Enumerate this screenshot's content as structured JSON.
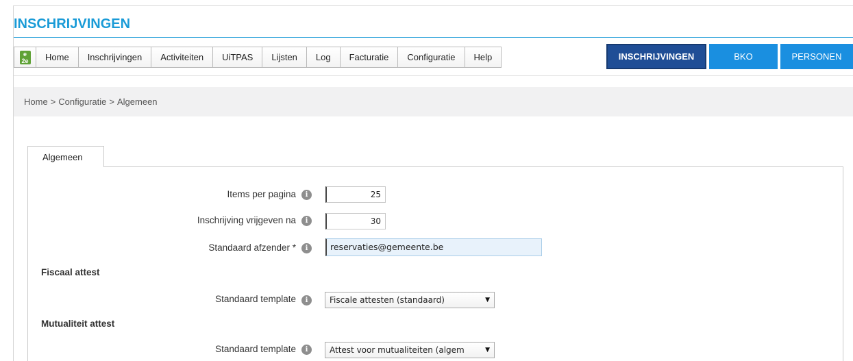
{
  "app": {
    "title": "INSCHRIJVINGEN"
  },
  "menu": {
    "logo": "e2e-logo-icon",
    "items": [
      "Home",
      "Inschrijvingen",
      "Activiteiten",
      "UiTPAS",
      "Lijsten",
      "Log",
      "Facturatie",
      "Configuratie",
      "Help"
    ]
  },
  "modules": {
    "inschrijvingen": "INSCHRIJVINGEN",
    "bko": "BKO",
    "personen": "PERSONEN",
    "active": "INSCHRIJVINGEN"
  },
  "breadcrumb": {
    "home": "Home",
    "sep": ">",
    "configuratie": "Configuratie",
    "current": "Algemeen"
  },
  "tab": {
    "label": "Algemeen"
  },
  "form": {
    "items_per_page": {
      "label": "Items per pagina",
      "value": "25"
    },
    "release_after": {
      "label": "Inschrijving vrijgeven na",
      "value": "30"
    },
    "default_sender": {
      "label": "Standaard afzender *",
      "value": "reservaties@gemeente.be"
    },
    "fiscal": {
      "title": "Fiscaal attest",
      "template_label": "Standaard template",
      "template_value": "Fiscale attesten (standaard)"
    },
    "mutual": {
      "title": "Mutualiteit attest",
      "template_label": "Standaard template",
      "template_value": "Attest voor mutualiteiten (algem"
    }
  },
  "colors": {
    "accent": "#1a9bd7",
    "module_active": "#1f4e96",
    "module_normal": "#1a8fe0",
    "logo_green": "#5fa236"
  }
}
